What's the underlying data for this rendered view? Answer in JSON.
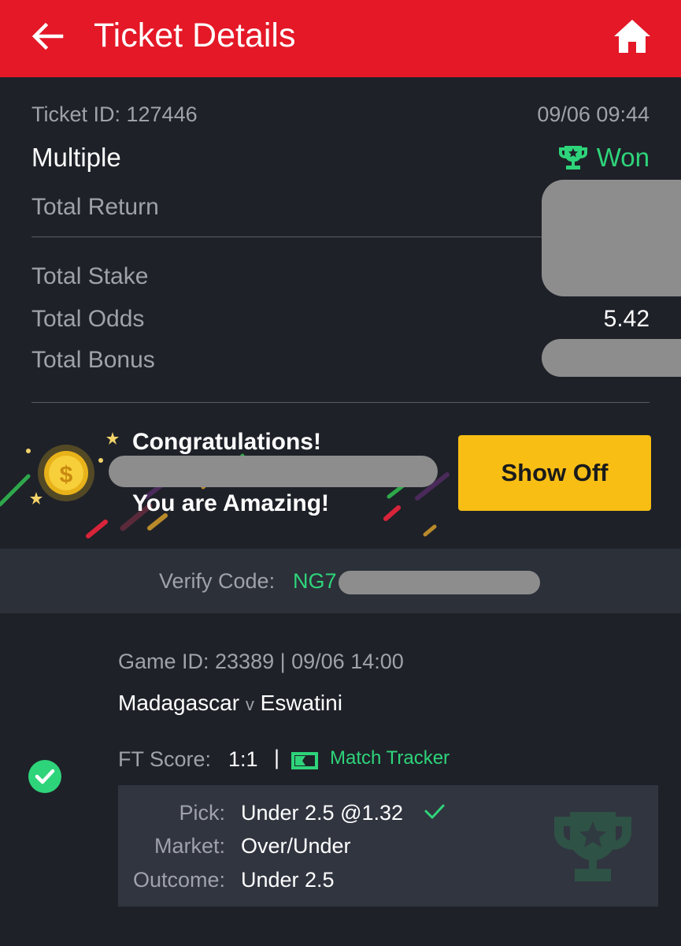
{
  "header": {
    "title": "Ticket Details",
    "back_icon": "arrow-left-icon",
    "home_icon": "home-icon",
    "background": "#e41827"
  },
  "ticket": {
    "id_text": "Ticket ID: 127446",
    "date": "09/06 09:44",
    "type": "Multiple",
    "status": "Won",
    "status_color": "#2ed47a",
    "rows": {
      "total_return_label": "Total Return",
      "total_stake_label": "Total Stake",
      "total_odds_label": "Total Odds",
      "total_odds_value": "5.42",
      "total_bonus_label": "Total Bonus"
    }
  },
  "banner": {
    "congrats": "Congratulations!",
    "amazing": "You are Amazing!",
    "show_off": "Show Off",
    "button_color": "#f8be14"
  },
  "verify": {
    "label": "Verify Code:",
    "code_prefix": "NG7"
  },
  "game": {
    "meta": "Game ID: 23389 | 09/06 14:00",
    "home_team": "Madagascar",
    "vs": "v",
    "away_team": "Eswatini",
    "ft_label": "FT Score:",
    "ft_score": "1:1",
    "separator": "|",
    "tracker": "Match Tracker",
    "pick_label": "Pick:",
    "pick_value": "Under 2.5 @1.32",
    "market_label": "Market:",
    "market_value": "Over/Under",
    "outcome_label": "Outcome:",
    "outcome_value": "Under 2.5"
  }
}
